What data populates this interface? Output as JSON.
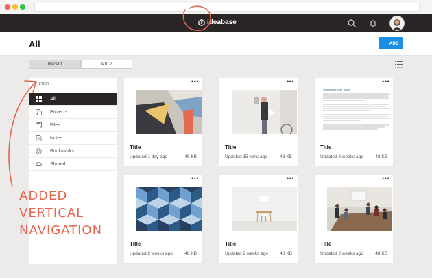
{
  "browser": {
    "dots": [
      "#ff5f57",
      "#febc2e",
      "#28c840"
    ]
  },
  "app": {
    "logo_text": "ideabase"
  },
  "header": {
    "title": "All",
    "add_label": "ADD"
  },
  "sort_tabs": {
    "recent": "Recent",
    "az": "A to Z"
  },
  "sidebar": {
    "filter_label": "FILTER",
    "items": [
      {
        "label": "All",
        "icon": "grid-icon",
        "active": true
      },
      {
        "label": "Projects",
        "icon": "projects-icon",
        "active": false
      },
      {
        "label": "Files",
        "icon": "files-icon",
        "active": false
      },
      {
        "label": "Notes",
        "icon": "notes-icon",
        "active": false
      },
      {
        "label": "Bookmarks",
        "icon": "bookmark-icon",
        "active": false
      },
      {
        "label": "Shared",
        "icon": "shared-icon",
        "active": false
      }
    ]
  },
  "cards": [
    {
      "title": "Title",
      "updated": "Updated 1 day ago",
      "size": "48 KB",
      "thumb": "abstract-art"
    },
    {
      "title": "Title",
      "updated": "Updated 15 mins ago",
      "size": "48 KB",
      "thumb": "person-video"
    },
    {
      "title": "Title",
      "updated": "Updated 2 weeks ago",
      "size": "48 KB",
      "thumb": "document"
    },
    {
      "title": "Title",
      "updated": "Updated 2 weeks ago",
      "size": "48 KB",
      "thumb": "blue-cubes"
    },
    {
      "title": "Title",
      "updated": "Updated 2 weeks ago",
      "size": "48 KB",
      "thumb": "desk"
    },
    {
      "title": "Title",
      "updated": "Updated 2 weeks ago",
      "size": "48 KB",
      "thumb": "meeting"
    }
  ],
  "document_preview": {
    "heading": "Structuring Your Story"
  },
  "annotation": {
    "line1": "ADDED",
    "line2": "VERTICAL",
    "line3": "NAVIGATION",
    "color": "#e6654f"
  },
  "colors": {
    "accent": "#1a8fe3",
    "topbar": "#2a2626",
    "annotation": "#e6654f"
  }
}
